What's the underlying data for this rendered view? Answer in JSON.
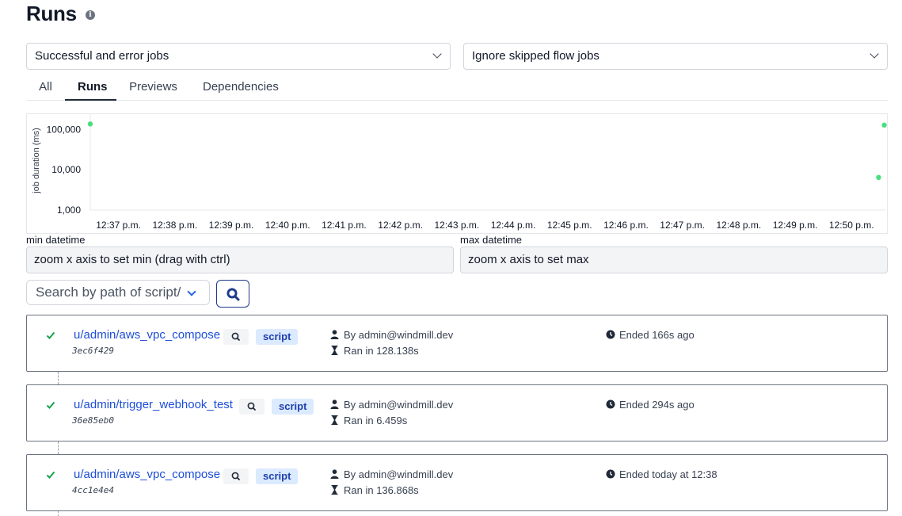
{
  "header": {
    "title": "Runs",
    "info_icon": "info-icon"
  },
  "filters": {
    "job_kinds": "Successful and error jobs",
    "skipped": "Ignore skipped flow jobs"
  },
  "tabs": [
    {
      "label": "All",
      "active": false
    },
    {
      "label": "Runs",
      "active": true
    },
    {
      "label": "Previews",
      "active": false
    },
    {
      "label": "Dependencies",
      "active": false
    }
  ],
  "chart_data": {
    "type": "scatter",
    "ylabel": "job duration (ms)",
    "yscale": "log",
    "ylim": [
      1000,
      200000
    ],
    "yticks": [
      "100,000",
      "10,000",
      "1,000"
    ],
    "xticks": [
      "12:37 p.m.",
      "12:38 p.m.",
      "12:39 p.m.",
      "12:40 p.m.",
      "12:41 p.m.",
      "12:42 p.m.",
      "12:43 p.m.",
      "12:44 p.m.",
      "12:45 p.m.",
      "12:46 p.m.",
      "12:47 p.m.",
      "12:48 p.m.",
      "12:49 p.m.",
      "12:50 p.m."
    ],
    "xlim_minutes": [
      36.5,
      50.6
    ],
    "points": [
      {
        "x_minute": 36.5,
        "y": 136868
      },
      {
        "x_minute": 50.58,
        "y": 128138
      },
      {
        "x_minute": 50.48,
        "y": 6459
      }
    ],
    "point_color": "#4ade80",
    "grid": false
  },
  "range": {
    "min_label": "min datetime",
    "min_value": "zoom x axis to set min (drag with ctrl)",
    "max_label": "max datetime",
    "max_value": "zoom x axis to set max"
  },
  "search": {
    "placeholder": "Search by path of script/"
  },
  "runs": [
    {
      "path": "u/admin/aws_vpc_compose",
      "id": "3ec6f429",
      "kind": "script",
      "by": "By admin@windmill.dev",
      "duration": "Ran in 128.138s",
      "ended": "Ended 166s ago",
      "status": "success"
    },
    {
      "path": "u/admin/trigger_webhook_test",
      "id": "36e85eb0",
      "kind": "script",
      "by": "By admin@windmill.dev",
      "duration": "Ran in 6.459s",
      "ended": "Ended 294s ago",
      "status": "success"
    },
    {
      "path": "u/admin/aws_vpc_compose",
      "id": "4cc1e4e4",
      "kind": "script",
      "by": "By admin@windmill.dev",
      "duration": "Ran in 136.868s",
      "ended": "Ended today at 12:38",
      "status": "success"
    }
  ],
  "colors": {
    "success": "#16a34a",
    "link": "#1d4ed8",
    "badge_bg": "#dbeafe",
    "badge_fg": "#1e40af"
  }
}
